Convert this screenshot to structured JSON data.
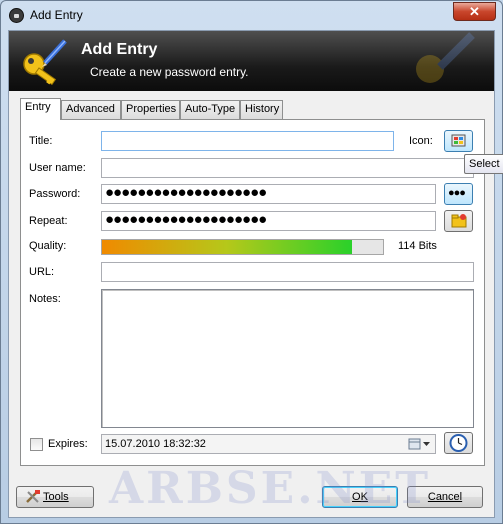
{
  "window": {
    "title": "Add Entry",
    "close_glyph": "✕"
  },
  "banner": {
    "title": "Add Entry",
    "subtitle": "Create a new password entry."
  },
  "tabs": [
    {
      "label": "Entry",
      "active": true
    },
    {
      "label": "Advanced"
    },
    {
      "label": "Properties"
    },
    {
      "label": "Auto-Type"
    },
    {
      "label": "History"
    }
  ],
  "form": {
    "title_label": "Title:",
    "title_value": "",
    "icon_label": "Icon:",
    "username_label": "User name:",
    "username_value": "",
    "password_label": "Password:",
    "password_value": "●●●●●●●●●●●●●●●●●●●●",
    "repeat_label": "Repeat:",
    "repeat_value": "●●●●●●●●●●●●●●●●●●●●",
    "show_password_glyph": "●●●",
    "quality_label": "Quality:",
    "quality_fraction": 0.89,
    "quality_text": "114 Bits",
    "url_label": "URL:",
    "url_value": "",
    "notes_label": "Notes:",
    "notes_value": "",
    "expires_label": "Expires:",
    "expires_checked": false,
    "expires_value": "15.07.2010 18:32:32"
  },
  "tooltip": {
    "text": "Select a"
  },
  "footer": {
    "tools_label": "Tools",
    "ok_label": "OK",
    "cancel_label": "Cancel"
  },
  "watermark": "ARBSE.NET",
  "icons": [
    "lock-icon",
    "close-icon",
    "key-icon",
    "pen-icon",
    "icon-picker-icon",
    "show-password-icon",
    "password-generator-icon",
    "calendar-dropdown-icon",
    "clock-icon",
    "tools-icon"
  ],
  "colors": {
    "banner": "#1a1a1a",
    "quality_start": "#f08a00",
    "quality_end": "#2ad12a",
    "focus": "#7eb4ea"
  }
}
